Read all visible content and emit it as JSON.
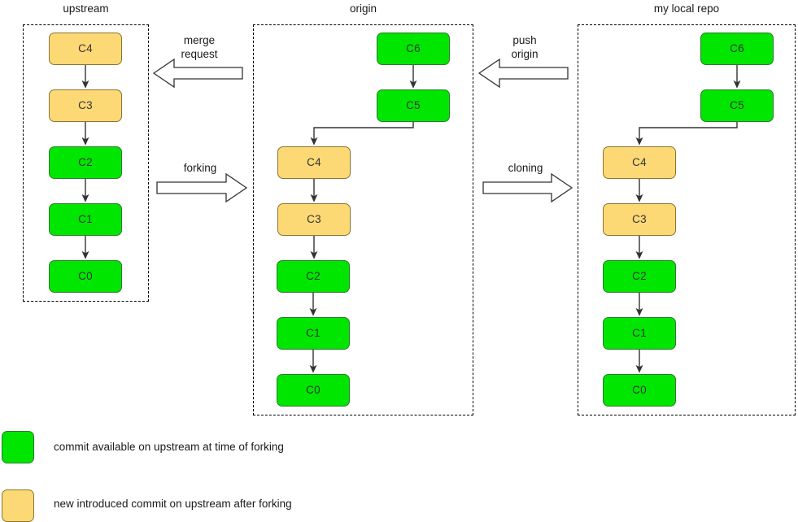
{
  "diagram": {
    "title_upstream": "upstream",
    "title_origin": "origin",
    "title_local": "my local repo"
  },
  "columns": [
    {
      "id": "upstream",
      "title": "upstream",
      "commits": [
        {
          "label": "C4",
          "kind": "orange"
        },
        {
          "label": "C3",
          "kind": "orange"
        },
        {
          "label": "C2",
          "kind": "green"
        },
        {
          "label": "C1",
          "kind": "green"
        },
        {
          "label": "C0",
          "kind": "green"
        }
      ]
    },
    {
      "id": "origin",
      "title": "origin",
      "commits": [
        {
          "label": "C6",
          "kind": "green"
        },
        {
          "label": "C5",
          "kind": "green"
        },
        {
          "label": "C4",
          "kind": "orange"
        },
        {
          "label": "C3",
          "kind": "orange"
        },
        {
          "label": "C2",
          "kind": "green"
        },
        {
          "label": "C1",
          "kind": "green"
        },
        {
          "label": "C0",
          "kind": "green"
        }
      ]
    },
    {
      "id": "local",
      "title": "my local repo",
      "commits": [
        {
          "label": "C6",
          "kind": "green"
        },
        {
          "label": "C5",
          "kind": "green"
        },
        {
          "label": "C4",
          "kind": "orange"
        },
        {
          "label": "C3",
          "kind": "orange"
        },
        {
          "label": "C2",
          "kind": "green"
        },
        {
          "label": "C1",
          "kind": "green"
        },
        {
          "label": "C0",
          "kind": "green"
        }
      ]
    }
  ],
  "flows": [
    {
      "id": "merge-request",
      "label": "merge\nrequest",
      "direction": "left"
    },
    {
      "id": "forking",
      "label": "forking",
      "direction": "right"
    },
    {
      "id": "push-origin",
      "label": "push\norigin",
      "direction": "left"
    },
    {
      "id": "cloning",
      "label": "cloning",
      "direction": "right"
    }
  ],
  "legend": [
    {
      "kind": "green",
      "text": "commit available on upstream at time of forking"
    },
    {
      "kind": "orange",
      "text": "new introduced commit on upstream after forking"
    }
  ],
  "colors": {
    "commit_available": "#00e600",
    "commit_new": "#fcd975",
    "container_border": "#000000",
    "connector": "#333333"
  }
}
